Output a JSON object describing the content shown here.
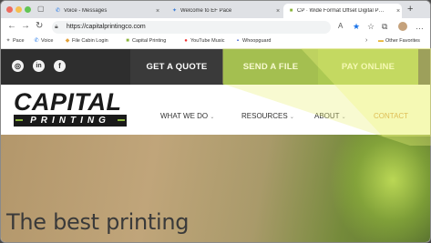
{
  "browser": {
    "tabs": [
      {
        "title": "Voice - Messages",
        "icon": "voice-icon",
        "active": false
      },
      {
        "title": "Welcome to EF Pace",
        "icon": "ef-icon",
        "active": false
      },
      {
        "title": "CP · Wide Format Offset Digital P…",
        "icon": "cp-icon",
        "active": true
      }
    ],
    "new_tab_label": "+",
    "url": "https://capitalprintingco.com",
    "bookmarks": [
      {
        "label": "Pace",
        "icon": "pace-icon"
      },
      {
        "label": "Voice",
        "icon": "voice-icon"
      },
      {
        "label": "File Cabin Login",
        "icon": "file-icon"
      },
      {
        "label": "Capital Printing",
        "icon": "cp-icon"
      },
      {
        "label": "YouTube Music",
        "icon": "youtube-icon"
      },
      {
        "label": "Whoopguard",
        "icon": "bookmark-icon"
      },
      {
        "label": "Other Favorites",
        "icon": "folder-icon"
      }
    ]
  },
  "site": {
    "social": [
      {
        "icon": "instagram-icon",
        "glyph": "◎"
      },
      {
        "icon": "linkedin-icon",
        "glyph": "in"
      },
      {
        "icon": "facebook-icon",
        "glyph": "f"
      }
    ],
    "cta": {
      "quote": "GET A QUOTE",
      "send": "SEND A FILE",
      "pay": "PAY ONLINE"
    },
    "logo": {
      "line1": "CAPITAL",
      "line2": "PRINTING"
    },
    "nav": [
      {
        "label": "WHAT WE DO",
        "has_dropdown": true
      },
      {
        "label": "RESOURCES",
        "has_dropdown": true
      },
      {
        "label": "ABOUT",
        "has_dropdown": true
      },
      {
        "label": "CONTACT",
        "has_dropdown": false
      }
    ],
    "hero_title": "The best printing"
  },
  "colors": {
    "accent_green": "#8ab43c",
    "dark_bar": "#2e2e2e",
    "contact_orange": "#c8741e",
    "highlighter": "#ecf27a"
  }
}
